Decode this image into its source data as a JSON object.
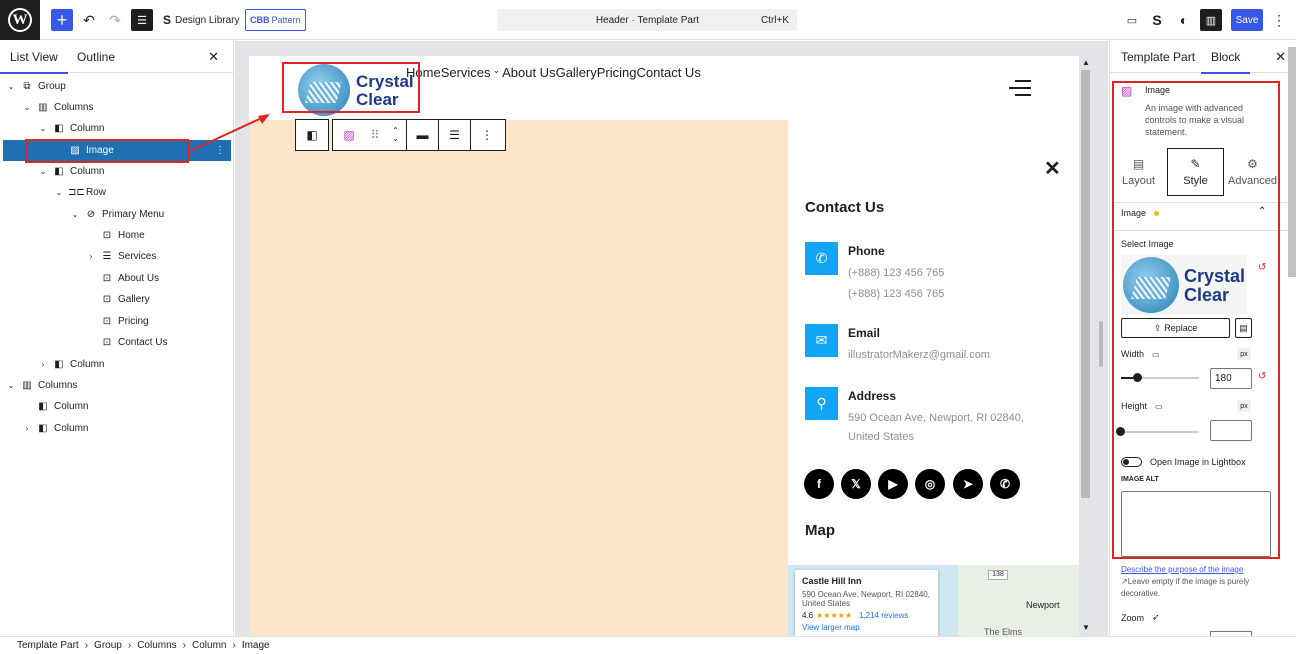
{
  "topbar": {
    "design_library": "Design Library",
    "pattern": "Pattern",
    "pattern_badge": "CBB",
    "command_title": "Header · Template Part",
    "command_shortcut": "Ctrl+K",
    "save": "Save"
  },
  "list_view": {
    "tab_list": "List View",
    "tab_outline": "Outline",
    "items": [
      {
        "label": "Group"
      },
      {
        "label": "Columns"
      },
      {
        "label": "Column"
      },
      {
        "label": "Image"
      },
      {
        "label": "Column"
      },
      {
        "label": "Row"
      },
      {
        "label": "Primary Menu"
      },
      {
        "label": "Home"
      },
      {
        "label": "Services"
      },
      {
        "label": "About Us"
      },
      {
        "label": "Gallery"
      },
      {
        "label": "Pricing"
      },
      {
        "label": "Contact Us"
      },
      {
        "label": "Column"
      },
      {
        "label": "Columns"
      },
      {
        "label": "Column"
      },
      {
        "label": "Column"
      }
    ]
  },
  "canvas": {
    "logo_line1": "Crystal",
    "logo_line2": "Clear",
    "nav": [
      "Home",
      "Services",
      "About Us",
      "Gallery",
      "Pricing",
      "Contact Us"
    ],
    "contact_heading": "Contact Us",
    "phone_title": "Phone",
    "phone1": "(+888) 123 456 765",
    "phone2": "(+888) 123 456 765",
    "email_title": "Email",
    "email": "illustratorMakerz@gmail.com",
    "address_title": "Address",
    "address1": "590 Ocean Ave, Newport, RI 02840,",
    "address2": "United States",
    "map_heading": "Map",
    "map_place": "Castle Hill Inn",
    "map_address1": "590 Ocean Ave, Newport, RI 02840,",
    "map_address2": "United States",
    "map_rating": "4.6",
    "map_stars": "★★★★★",
    "map_reviews": "1,214 reviews",
    "map_link": "View larger map",
    "map_city": "Newport",
    "map_area": "The Elms",
    "map_route": "138"
  },
  "inspector": {
    "tab_template": "Template Part",
    "tab_block": "Block",
    "block_name": "Image",
    "block_desc": "An image with advanced controls to make a visual statement.",
    "tabs": [
      "Layout",
      "Style",
      "Advanced"
    ],
    "section_image": "Image",
    "select_image": "Select Image",
    "replace": "Replace",
    "width_label": "Width",
    "width_value": "180",
    "width_unit": "px",
    "width_slider_fraction": 0.18,
    "height_label": "Height",
    "height_value": "",
    "height_unit": "px",
    "height_slider_fraction": 0,
    "lightbox_label": "Open Image in Lightbox",
    "image_alt_label": "IMAGE ALT",
    "alt_link": "Describe the purpose of the image",
    "alt_help": "Leave empty if the image is purely decorative.",
    "zoom_label": "Zoom"
  },
  "breadcrumb": [
    "Template Part",
    "Group",
    "Columns",
    "Column",
    "Image"
  ],
  "colors": {
    "accent": "#3858e9",
    "selection": "#1f6fb2",
    "highlight": "#e02424",
    "contact_icon": "#13a5f5",
    "peach": "#fde5c9"
  }
}
